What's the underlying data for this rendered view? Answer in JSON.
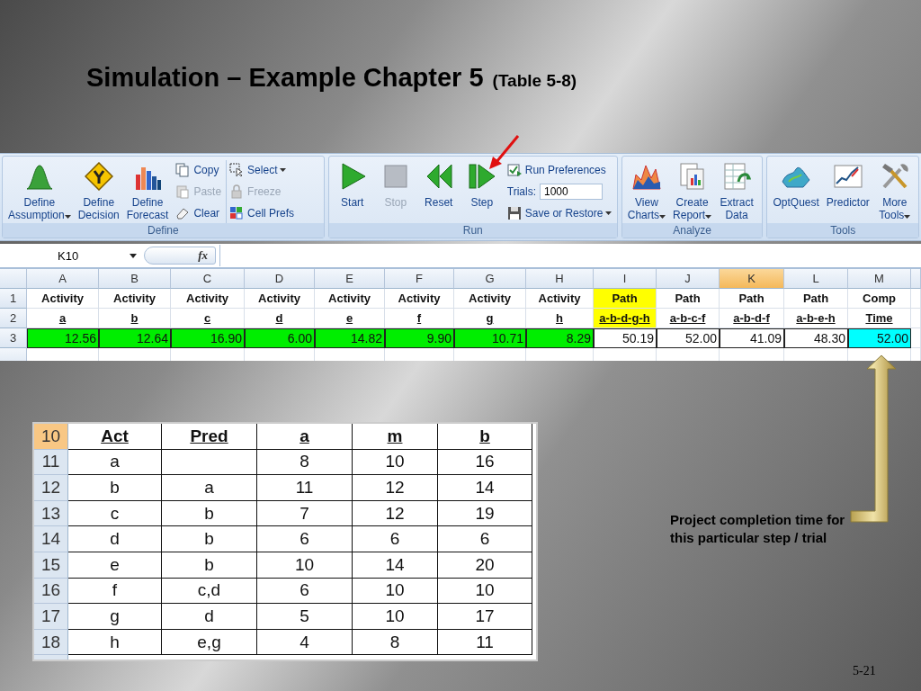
{
  "slide": {
    "title": "Simulation – Example Chapter 5",
    "title_note": "(Table 5-8)",
    "annotation": "Project completion time for this particular step / trial",
    "page_number": "5-21"
  },
  "ribbon": {
    "groups": [
      {
        "label": "Define",
        "items": [
          {
            "kind": "large",
            "label": "Define\nAssumption",
            "dropdown": true,
            "disabled": false
          },
          {
            "kind": "large",
            "label": "Define\nDecision",
            "dropdown": false,
            "disabled": false
          },
          {
            "kind": "large",
            "label": "Define\nForecast",
            "dropdown": false,
            "disabled": false
          },
          {
            "kind": "stack",
            "items": [
              {
                "kind": "button",
                "label": "Copy",
                "dropdown": false,
                "disabled": false
              },
              {
                "kind": "button",
                "label": "Paste",
                "dropdown": false,
                "disabled": true
              },
              {
                "kind": "button",
                "label": "Clear",
                "dropdown": false,
                "disabled": false
              }
            ]
          },
          {
            "kind": "stack",
            "items": [
              {
                "kind": "button",
                "label": "Select",
                "dropdown": true,
                "disabled": false
              },
              {
                "kind": "button",
                "label": "Freeze",
                "dropdown": false,
                "disabled": true
              },
              {
                "kind": "button",
                "label": "Cell Prefs",
                "dropdown": false,
                "disabled": false
              }
            ]
          }
        ]
      },
      {
        "label": "Run",
        "items": [
          {
            "kind": "large",
            "label": "Start",
            "dropdown": false,
            "disabled": false
          },
          {
            "kind": "large",
            "label": "Stop",
            "dropdown": false,
            "disabled": true
          },
          {
            "kind": "large",
            "label": "Reset",
            "dropdown": false,
            "disabled": false
          },
          {
            "kind": "large",
            "label": "Step",
            "dropdown": false,
            "disabled": false
          },
          {
            "kind": "stack",
            "items": [
              {
                "kind": "button",
                "label": "Run Preferences",
                "dropdown": false,
                "disabled": false
              },
              {
                "kind": "field",
                "label": "Trials:",
                "value": "1000"
              },
              {
                "kind": "button",
                "label": "Save or Restore",
                "dropdown": true,
                "disabled": false
              }
            ]
          }
        ]
      },
      {
        "label": "Analyze",
        "items": [
          {
            "kind": "large",
            "label": "View\nCharts",
            "dropdown": true,
            "disabled": false
          },
          {
            "kind": "large",
            "label": "Create\nReport",
            "dropdown": true,
            "disabled": false
          },
          {
            "kind": "large",
            "label": "Extract\nData",
            "dropdown": false,
            "disabled": false
          }
        ]
      },
      {
        "label": "Tools",
        "items": [
          {
            "kind": "large",
            "label": "OptQuest",
            "dropdown": false,
            "disabled": false
          },
          {
            "kind": "large",
            "label": "Predictor",
            "dropdown": false,
            "disabled": false
          },
          {
            "kind": "large",
            "label": "More\nTools",
            "dropdown": true,
            "disabled": false
          }
        ]
      }
    ]
  },
  "formula_bar": {
    "name_box": "K10",
    "function_label": "fx"
  },
  "sheet": {
    "columns": [
      {
        "label": "A",
        "selected": false
      },
      {
        "label": "B",
        "selected": false
      },
      {
        "label": "C",
        "selected": false
      },
      {
        "label": "D",
        "selected": false
      },
      {
        "label": "E",
        "selected": false
      },
      {
        "label": "F",
        "selected": false
      },
      {
        "label": "G",
        "selected": false
      },
      {
        "label": "H",
        "selected": false
      },
      {
        "label": "I",
        "selected": false
      },
      {
        "label": "J",
        "selected": false
      },
      {
        "label": "K",
        "selected": true
      },
      {
        "label": "L",
        "selected": false
      },
      {
        "label": "M",
        "selected": false
      }
    ],
    "rows": [
      {
        "number": "1",
        "kind": "label",
        "cells": [
          {
            "text": "Activity"
          },
          {
            "text": "Activity"
          },
          {
            "text": "Activity"
          },
          {
            "text": "Activity"
          },
          {
            "text": "Activity"
          },
          {
            "text": "Activity"
          },
          {
            "text": "Activity"
          },
          {
            "text": "Activity"
          },
          {
            "text": "Path",
            "color": "#ffff00"
          },
          {
            "text": "Path"
          },
          {
            "text": "Path"
          },
          {
            "text": "Path"
          },
          {
            "text": "Comp"
          }
        ]
      },
      {
        "number": "2",
        "kind": "sublabel",
        "cells": [
          {
            "text": "a"
          },
          {
            "text": "b"
          },
          {
            "text": "c"
          },
          {
            "text": "d"
          },
          {
            "text": "e"
          },
          {
            "text": "f"
          },
          {
            "text": "g"
          },
          {
            "text": "h"
          },
          {
            "text": "a-b-d-g-h",
            "color": "#ffff00"
          },
          {
            "text": "a-b-c-f"
          },
          {
            "text": "a-b-d-f"
          },
          {
            "text": "a-b-e-h"
          },
          {
            "text": "Time"
          }
        ]
      },
      {
        "number": "3",
        "kind": "value",
        "cells": [
          {
            "text": "12.56",
            "color": "#00ee00"
          },
          {
            "text": "12.64",
            "color": "#00ee00"
          },
          {
            "text": "16.90",
            "color": "#00ee00"
          },
          {
            "text": "6.00",
            "color": "#00ee00"
          },
          {
            "text": "14.82",
            "color": "#00ee00"
          },
          {
            "text": "9.90",
            "color": "#00ee00"
          },
          {
            "text": "10.71",
            "color": "#00ee00"
          },
          {
            "text": "8.29",
            "color": "#00ee00"
          },
          {
            "text": "50.19"
          },
          {
            "text": "52.00"
          },
          {
            "text": "41.09"
          },
          {
            "text": "48.30"
          },
          {
            "text": "52.00",
            "color": "#00ffff"
          }
        ]
      }
    ]
  },
  "table": {
    "header": {
      "number": "10",
      "selected": true,
      "cells": [
        "Act",
        "Pred",
        "a",
        "m",
        "b"
      ]
    },
    "rows": [
      {
        "number": "11",
        "selected": false,
        "cells": [
          "a",
          null,
          "8",
          "10",
          "16"
        ]
      },
      {
        "number": "12",
        "selected": false,
        "cells": [
          "b",
          "a",
          "11",
          "12",
          "14"
        ]
      },
      {
        "number": "13",
        "selected": false,
        "cells": [
          "c",
          "b",
          "7",
          "12",
          "19"
        ]
      },
      {
        "number": "14",
        "selected": false,
        "cells": [
          "d",
          "b",
          "6",
          "6",
          "6"
        ]
      },
      {
        "number": "15",
        "selected": false,
        "cells": [
          "e",
          "b",
          "10",
          "14",
          "20"
        ]
      },
      {
        "number": "16",
        "selected": false,
        "cells": [
          "f",
          "c,d",
          "6",
          "10",
          "10"
        ]
      },
      {
        "number": "17",
        "selected": false,
        "cells": [
          "g",
          "d",
          "5",
          "10",
          "17"
        ]
      },
      {
        "number": "18",
        "selected": false,
        "cells": [
          "h",
          "e,g",
          "4",
          "8",
          "11"
        ]
      }
    ]
  }
}
